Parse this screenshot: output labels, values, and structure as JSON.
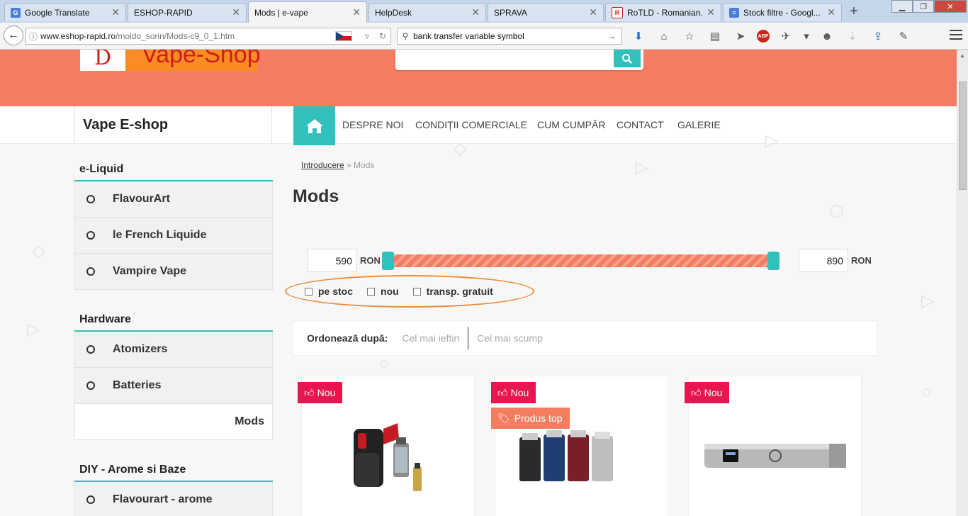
{
  "browser": {
    "tabs": [
      {
        "label": "Google Translate",
        "favicon": "google-translate",
        "color": "#4a7fd4",
        "active": false
      },
      {
        "label": "ESHOP-RAPID",
        "favicon": "blank",
        "color": "#c6d6ea",
        "active": false
      },
      {
        "label": "Mods | e-vape",
        "favicon": "blank",
        "color": "#f4f4f4",
        "active": true
      },
      {
        "label": "HelpDesk",
        "favicon": "blank",
        "color": "#c6d6ea",
        "active": false
      },
      {
        "label": "SPRAVA",
        "favicon": "blank",
        "color": "#c6d6ea",
        "active": false
      },
      {
        "label": "RoTLD - Romanian...",
        "favicon": "rotld",
        "color": "#d31c1c",
        "active": false
      },
      {
        "label": "Stock filtre - Googl...",
        "favicon": "google-docs",
        "color": "#4a7fd4",
        "active": false
      }
    ],
    "url_domain": "www.eshop-rapid.ro",
    "url_path": "/moldo_sorin/Mods-c9_0_1.htm",
    "search_value": "bank transfer variable symbol",
    "toolbar_icons": [
      "download-icon",
      "home-icon",
      "bookmark-star-icon",
      "reader-list-icon",
      "send-icon",
      "adblock-icon",
      "extension-icon",
      "chevron-down-icon",
      "emoji-icon",
      "download-disabled-icon",
      "upload-icon",
      "notes-icon"
    ],
    "adblock_label": "ABP"
  },
  "site": {
    "logo_letter": "D",
    "logo_text": "Vape-Shop",
    "brand": "Vape E-shop",
    "nav": [
      "DESPRE NOI",
      "CONDIȚII COMERCIALE",
      "CUM CUMPĂR",
      "CONTACT",
      "GALERIE"
    ],
    "accent": "#32c0bd",
    "hero_color": "#f47d61"
  },
  "sidebar": [
    {
      "title": "e-Liquid",
      "items": [
        "FlavourArt",
        "le French Liquide",
        "Vampire Vape"
      ]
    },
    {
      "title": "Hardware",
      "items": [
        "Atomizers",
        "Batteries",
        "Mods"
      ],
      "active": "Mods"
    },
    {
      "title": "DIY - Arome si Baze",
      "items": [
        "Flavourart - arome"
      ]
    }
  ],
  "main": {
    "breadcrumb_link": "Introducere",
    "breadcrumb_sep": " » ",
    "breadcrumb_current": "Mods",
    "title": "Mods",
    "price_min": "590",
    "price_max": "890",
    "currency": "RON",
    "filters": [
      "pe stoc",
      "nou",
      "transp. gratuit"
    ],
    "sort_label": "Ordonează după:",
    "sort_options": [
      "Cel mai ieftin",
      "Cel mai scump"
    ],
    "products": [
      {
        "badges": [
          "Nou"
        ]
      },
      {
        "badges": [
          "Nou",
          "Produs top"
        ]
      },
      {
        "badges": [
          "Nou"
        ]
      }
    ]
  }
}
